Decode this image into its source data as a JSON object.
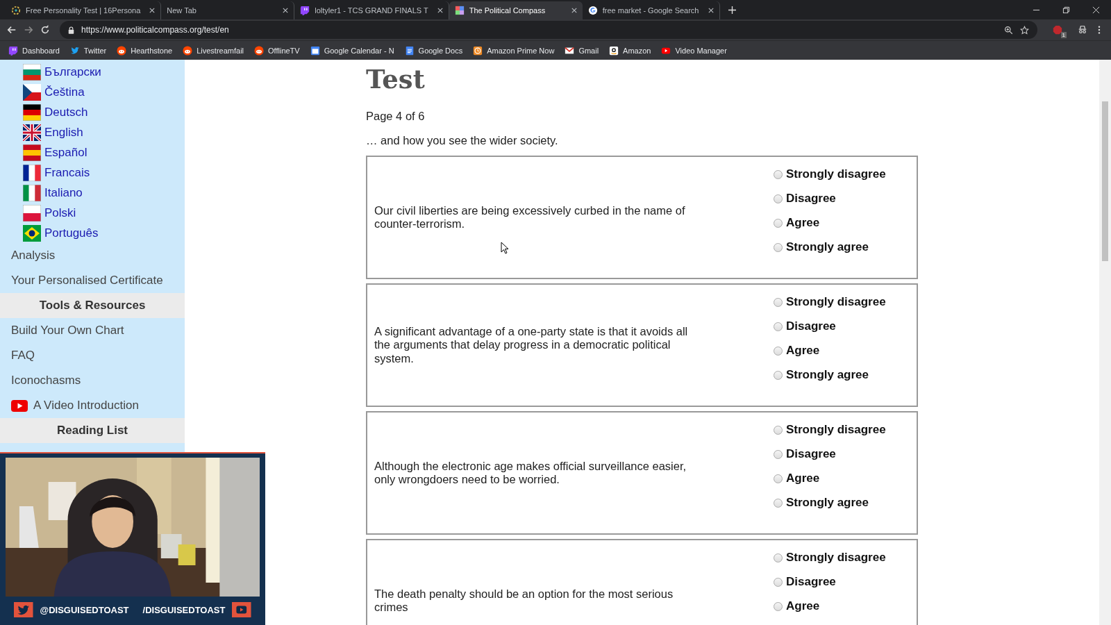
{
  "tabs": [
    {
      "title": "Free Personality Test | 16Persona",
      "selected": false
    },
    {
      "title": "New Tab",
      "selected": false
    },
    {
      "title": "loltyler1 - TCS GRAND FINALS T",
      "selected": false
    },
    {
      "title": "The Political Compass",
      "selected": true
    },
    {
      "title": "free market - Google Search",
      "selected": false
    }
  ],
  "address_bar": {
    "url": "https://www.politicalcompass.org/test/en",
    "extension_badge": "1"
  },
  "bookmarks": [
    {
      "label": "Dashboard"
    },
    {
      "label": "Twitter"
    },
    {
      "label": "Hearthstone"
    },
    {
      "label": "Livestreamfail"
    },
    {
      "label": "OfflineTV"
    },
    {
      "label": "Google Calendar - N"
    },
    {
      "label": "Google Docs"
    },
    {
      "label": "Amazon Prime Now"
    },
    {
      "label": "Gmail"
    },
    {
      "label": "Amazon"
    },
    {
      "label": "Video Manager"
    }
  ],
  "sidebar": {
    "items": [
      {
        "kind": "language",
        "label": "Български"
      },
      {
        "kind": "language",
        "label": "Čeština"
      },
      {
        "kind": "language",
        "label": "Deutsch"
      },
      {
        "kind": "language",
        "label": "English"
      },
      {
        "kind": "language",
        "label": "Español"
      },
      {
        "kind": "language",
        "label": "Francais"
      },
      {
        "kind": "language",
        "label": "Italiano"
      },
      {
        "kind": "language",
        "label": "Polski"
      },
      {
        "kind": "language",
        "label": "Português"
      },
      {
        "kind": "link",
        "label": "Analysis"
      },
      {
        "kind": "link",
        "label": "Your Personalised Certificate"
      },
      {
        "kind": "heading",
        "label": "Tools & Resources"
      },
      {
        "kind": "link",
        "label": "Build Your Own Chart"
      },
      {
        "kind": "link",
        "label": "FAQ"
      },
      {
        "kind": "link",
        "label": "Iconochasms"
      },
      {
        "kind": "video",
        "label": "A Video Introduction"
      },
      {
        "kind": "heading",
        "label": "Reading List"
      }
    ]
  },
  "page": {
    "title": "Test",
    "progress": "Page 4 of 6",
    "intro": "… and how you see the wider society.",
    "questions": [
      {
        "text": "Our civil liberties are being excessively curbed in the name of counter-terrorism.",
        "options": [
          {
            "label": "Strongly disagree",
            "selected": false
          },
          {
            "label": "Disagree",
            "selected": false
          },
          {
            "label": "Agree",
            "selected": false
          },
          {
            "label": "Strongly agree",
            "selected": false
          }
        ]
      },
      {
        "text": "A significant advantage of a one-party state is that it avoids all the arguments that delay progress in a democratic political system.",
        "options": [
          {
            "label": "Strongly disagree",
            "selected": false
          },
          {
            "label": "Disagree",
            "selected": false
          },
          {
            "label": "Agree",
            "selected": false
          },
          {
            "label": "Strongly agree",
            "selected": false
          }
        ]
      },
      {
        "text": "Although the electronic age makes official surveillance easier, only wrongdoers need to be worried.",
        "options": [
          {
            "label": "Strongly disagree",
            "selected": false
          },
          {
            "label": "Disagree",
            "selected": false
          },
          {
            "label": "Agree",
            "selected": false
          },
          {
            "label": "Strongly agree",
            "selected": false
          }
        ]
      },
      {
        "text": "The death penalty should be an option for the most serious crimes",
        "options": [
          {
            "label": "Strongly disagree",
            "selected": false
          },
          {
            "label": "Disagree",
            "selected": false
          },
          {
            "label": "Agree",
            "selected": false
          }
        ]
      }
    ]
  },
  "stream_overlay": {
    "twitter": "@DISGUISEDTOAST",
    "youtube": "/DISGUISEDTOAST"
  }
}
